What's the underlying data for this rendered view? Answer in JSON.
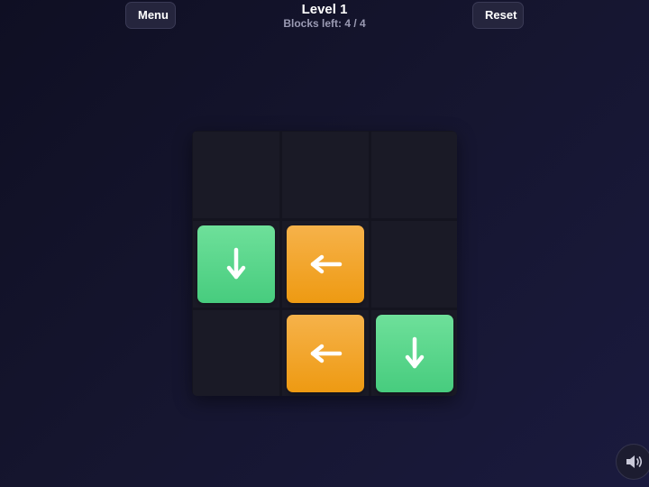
{
  "header": {
    "menu_label": "Menu",
    "reset_label": "Reset",
    "level_title": "Level 1",
    "blocks_left": "Blocks left: 4 / 4"
  },
  "board": {
    "rows": 3,
    "cols": 3,
    "blocks": [
      {
        "row": 1,
        "col": 0,
        "direction": "down",
        "color": "green",
        "icon": "arrow-down-icon"
      },
      {
        "row": 1,
        "col": 1,
        "direction": "left",
        "color": "orange",
        "icon": "arrow-left-icon"
      },
      {
        "row": 2,
        "col": 1,
        "direction": "left",
        "color": "orange",
        "icon": "arrow-left-icon"
      },
      {
        "row": 2,
        "col": 2,
        "direction": "down",
        "color": "green",
        "icon": "arrow-down-icon"
      }
    ]
  },
  "colors": {
    "green_top": "#6ee09a",
    "green_bottom": "#47cc7e",
    "orange_top": "#f6b24a",
    "orange_bottom": "#ee9a12",
    "cell": "#1a1a26",
    "background": "#15152e"
  },
  "sound": {
    "icon": "speaker-icon"
  }
}
